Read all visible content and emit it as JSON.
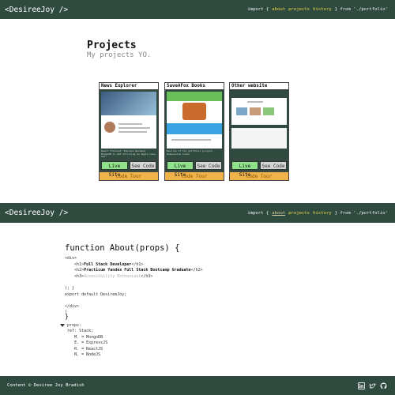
{
  "nav": {
    "brand": "<DesireeJoy />",
    "import_kw": "import {",
    "links": [
      "about",
      "projects",
      "history"
    ],
    "from_kw": "} from './portfolio'"
  },
  "projects": {
    "title": "Projects",
    "subtitle": "My projects YO.",
    "cards": [
      {
        "title": "News Explorer",
        "description": "React frontend, Express Backend, MongoDB on GCP utilizing an Apple news api.",
        "live_label": "Live Site",
        "code_label": "See Code",
        "tour_label": "Code Tour"
      },
      {
        "title": "SaveAFox Books",
        "description": "Rewrite of fox portfolio project. Responsive links.",
        "live_label": "Live Site",
        "code_label": "See Code",
        "tour_label": "Code Tour"
      },
      {
        "title": "Other website",
        "description": "",
        "live_label": "Live Site",
        "code_label": "See Code",
        "tour_label": "Code Tour"
      }
    ]
  },
  "about": {
    "heading": "function About(props) {",
    "open_div": "<div>",
    "h1_open": "<h1>",
    "h1_text": "Full Stack Developer",
    "h1_close": "</h1>",
    "h2_open": "<h2>",
    "h2_text": "Practicum Yandex Full Stack Bootcamp Graduate",
    "h2_close": "</h2>",
    "h3_open": "<h3>",
    "h3_text": "Accessibility Enthusiast",
    "h3_close": "</h3>",
    "close_paren": "); }",
    "export_line": "export default DesireeJoy;",
    "close_div": "</div>",
    "close_paren2": ")",
    "close_brace": "}",
    "props_label": "props:",
    "ref_label": "ref: Stack;",
    "stack": [
      "M. = MongoDB",
      "E. = ExpressJS",
      "R. = ReactJS",
      "N. = NodeJS"
    ]
  },
  "footer": {
    "text": "Content © Desiree Joy Bradish",
    "icons": [
      "linkedin-icon",
      "twitter-icon",
      "github-icon"
    ]
  },
  "colors": {
    "nav_bg": "#2f4a3f",
    "link": "#e9d844",
    "live_btn": "#8fe28a",
    "code_btn": "#d5d5d5",
    "tour_btn": "#f0b24a"
  }
}
